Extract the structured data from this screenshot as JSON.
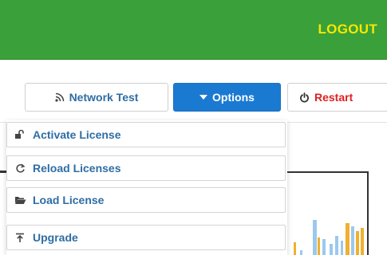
{
  "header": {
    "logout_label": "LOGOUT",
    "bar_color": "#3aa03a",
    "logout_color": "#f5e800"
  },
  "toolbar": {
    "network_test_label": "Network Test",
    "options_label": "Options",
    "restart_label": "Restart",
    "options_color": "#1a7ad2",
    "restart_color": "#e02020"
  },
  "options_menu": {
    "items": [
      {
        "label": "Activate License",
        "icon": "unlock-icon"
      },
      {
        "label": "Reload Licenses",
        "icon": "refresh-icon"
      },
      {
        "label": "Load License",
        "icon": "folder-open-icon"
      },
      {
        "label": "Upgrade",
        "icon": "upload-icon"
      }
    ]
  }
}
